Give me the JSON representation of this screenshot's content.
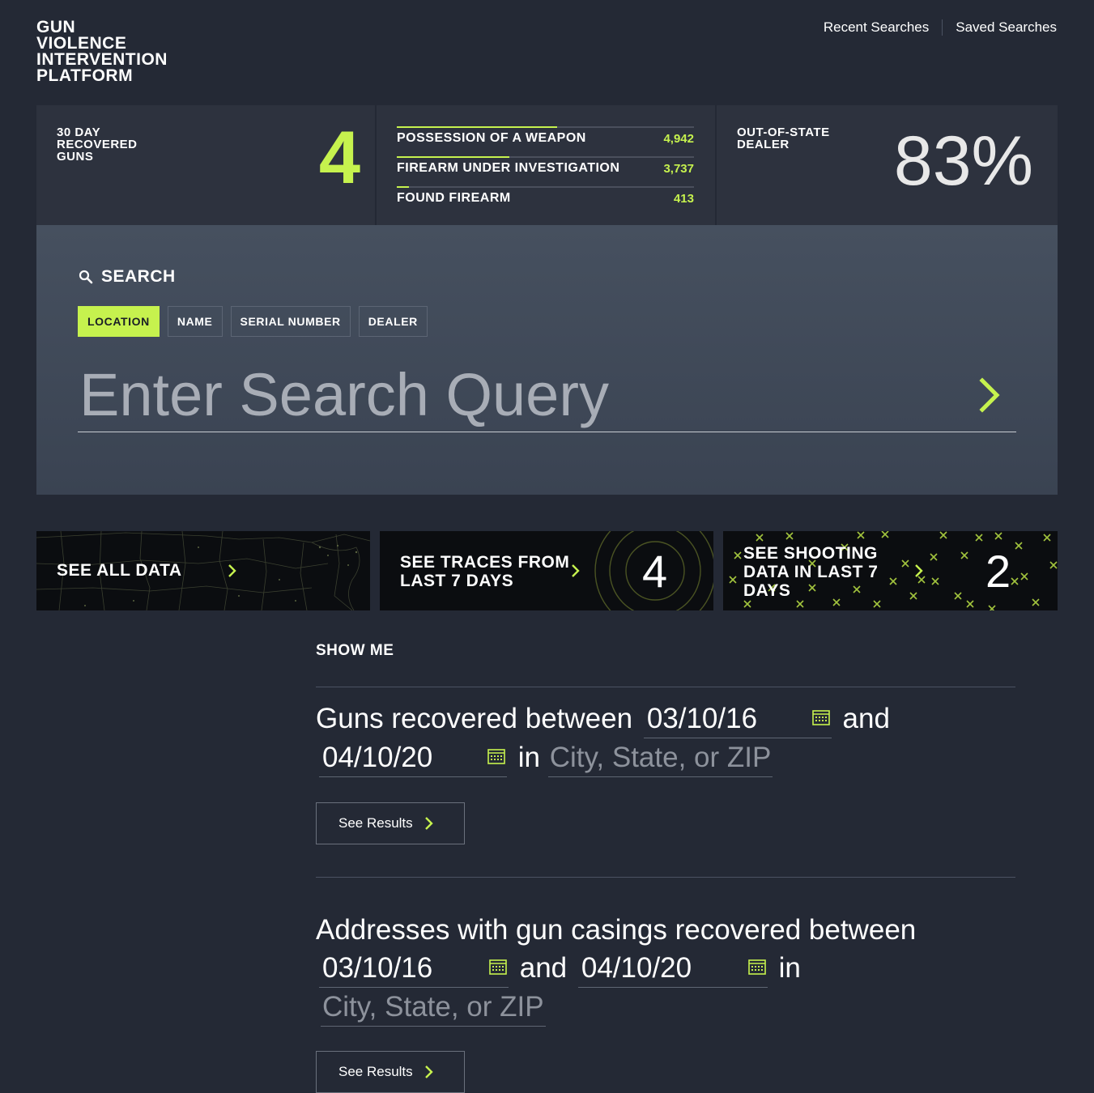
{
  "logo": {
    "lines": [
      "GUN",
      "VIOLENCE",
      "INTERVENTION",
      "PLATFORM"
    ]
  },
  "topnav": {
    "recent": "Recent Searches",
    "saved": "Saved Searches"
  },
  "stats": {
    "recovered": {
      "label": "30 DAY RECOVERED GUNS",
      "value": "4"
    },
    "categories": [
      {
        "label": "POSSESSION OF A WEAPON",
        "value": "4,942",
        "fraction": 0.54
      },
      {
        "label": "FIREARM UNDER INVESTIGATION",
        "value": "3,737",
        "fraction": 0.38
      },
      {
        "label": "FOUND FIREARM",
        "value": "413",
        "fraction": 0.04
      }
    ],
    "out_of_state": {
      "label": "OUT-OF-STATE DEALER",
      "value": "83%"
    }
  },
  "search": {
    "title": "SEARCH",
    "tabs": [
      "LOCATION",
      "NAME",
      "SERIAL NUMBER",
      "DEALER"
    ],
    "active_tab": "LOCATION",
    "placeholder": "Enter Search Query"
  },
  "cards": [
    {
      "label": "SEE ALL DATA"
    },
    {
      "label": "SEE TRACES FROM LAST 7 DAYS",
      "value": "4"
    },
    {
      "label": "SEE SHOOTING DATA IN LAST 7 DAYS",
      "value": "2"
    }
  ],
  "show_me": {
    "title": "SHOW ME",
    "q1": {
      "text1": "Guns recovered between",
      "date1": "03/10/16",
      "and": "and",
      "date2": "04/10/20",
      "in": "in",
      "location_placeholder": "City, State, or ZIP",
      "button": "See Results"
    },
    "q2": {
      "text1": "Addresses with gun casings recovered between",
      "date1": "03/10/16",
      "and": "and",
      "date2": "04/10/20",
      "in": "in",
      "location_placeholder": "City, State, or ZIP",
      "button": "See Results"
    }
  },
  "colors": {
    "accent": "#c6f24e",
    "background": "#242935",
    "panel": "#2d323e"
  }
}
